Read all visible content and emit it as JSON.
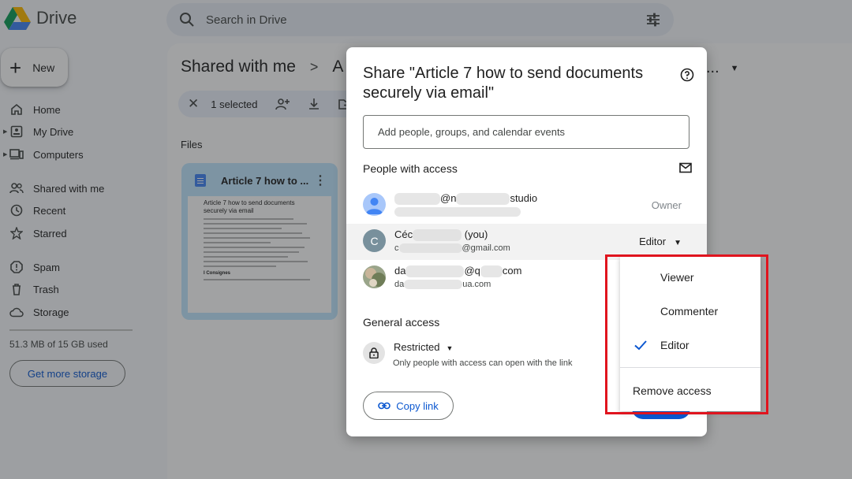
{
  "app": {
    "name": "Drive"
  },
  "search": {
    "placeholder": "Search in Drive"
  },
  "new_button": {
    "label": "New"
  },
  "sidebar": {
    "items": [
      {
        "label": "Home",
        "icon": "home-icon"
      },
      {
        "label": "My Drive",
        "icon": "my-drive-icon"
      },
      {
        "label": "Computers",
        "icon": "computers-icon"
      },
      {
        "label": "Shared with me",
        "icon": "shared-icon"
      },
      {
        "label": "Recent",
        "icon": "clock-icon"
      },
      {
        "label": "Starred",
        "icon": "star-icon"
      },
      {
        "label": "Spam",
        "icon": "spam-icon"
      },
      {
        "label": "Trash",
        "icon": "trash-icon"
      },
      {
        "label": "Storage",
        "icon": "cloud-icon"
      }
    ],
    "storage_used": "51.3 MB of 15 GB used",
    "storage_button": "Get more storage"
  },
  "main": {
    "breadcrumb": [
      "Shared with me",
      "A"
    ],
    "breadcrumb_overflow": "...",
    "selection": {
      "count_label": "1 selected"
    },
    "files_heading": "Files",
    "file_card": {
      "title": "Article 7 how to ...",
      "preview_title": "Article 7 how to send documents securely via email",
      "preview_heading": "I   Consignes"
    }
  },
  "dialog": {
    "title": "Share \"Article 7 how to send documents securely via email\"",
    "add_placeholder": "Add people, groups, and calendar events",
    "people_heading": "People with access",
    "people": [
      {
        "name_prefix": "",
        "name_mid": "@n",
        "name_suffix": "studio",
        "email": "",
        "role": "Owner"
      },
      {
        "name_prefix": "Céc",
        "name_suffix": "(you)",
        "email_prefix": "c",
        "email_suffix": "@gmail.com",
        "role": "Editor"
      },
      {
        "name_prefix": "da",
        "name_mid": "@q",
        "name_suffix": "com",
        "email_prefix": "da",
        "email_suffix": "ua.com"
      }
    ],
    "avatar_initial": "C",
    "general_access_heading": "General access",
    "access_level": "Restricted",
    "access_description": "Only people with access can open with the link",
    "copy_link": "Copy link"
  },
  "role_menu": {
    "options": [
      "Viewer",
      "Commenter",
      "Editor"
    ],
    "selected": "Editor",
    "remove": "Remove access"
  },
  "colors": {
    "accent": "#0b57d0",
    "highlight": "#e0141e",
    "selected_card": "#c2e7ff"
  }
}
